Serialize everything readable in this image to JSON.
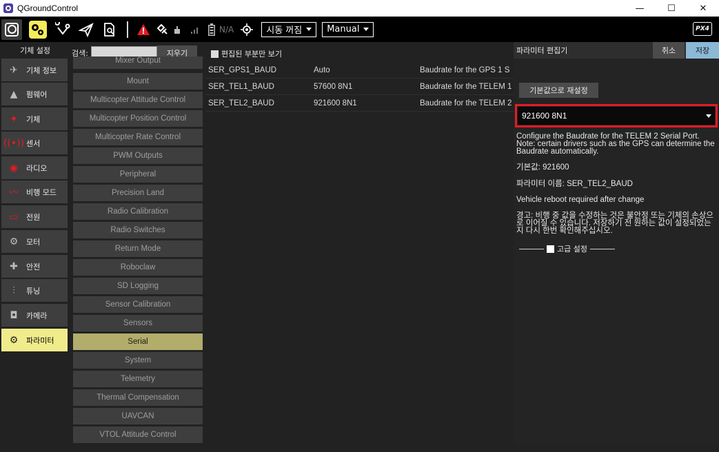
{
  "window": {
    "title": "QGroundControl",
    "controls": {
      "minimize": "—",
      "maximize": "☐",
      "close": "✕"
    }
  },
  "toolbar": {
    "gps_status": "N/A",
    "arm_dropdown": "시동 꺼짐",
    "mode_dropdown": "Manual",
    "logo": "PX4"
  },
  "leftnav": {
    "heading": "기체 설정",
    "items": [
      {
        "label": "기체 정보",
        "icon": "✈"
      },
      {
        "label": "펌웨어",
        "icon": "▲"
      },
      {
        "label": "기체",
        "icon": "✦"
      },
      {
        "label": "센서",
        "icon": "((•))"
      },
      {
        "label": "라디오",
        "icon": "◉"
      },
      {
        "label": "비행 모드",
        "icon": "〰"
      },
      {
        "label": "전원",
        "icon": "▭"
      },
      {
        "label": "모터",
        "icon": "⚙"
      },
      {
        "label": "안전",
        "icon": "✚"
      },
      {
        "label": "튜닝",
        "icon": "⫶"
      },
      {
        "label": "카메라",
        "icon": "◘"
      },
      {
        "label": "파라미터",
        "icon": "⚙"
      }
    ]
  },
  "search": {
    "label": "검색:",
    "value": "",
    "clear_label": "지우기",
    "edited_only_label": "편집된 부분만 보기"
  },
  "groups": [
    "Mixer Output",
    "Mount",
    "Multicopter Attitude Control",
    "Multicopter Position Control",
    "Multicopter Rate Control",
    "PWM Outputs",
    "Peripheral",
    "Precision Land",
    "Radio Calibration",
    "Radio Switches",
    "Return Mode",
    "Roboclaw",
    "SD Logging",
    "Sensor Calibration",
    "Sensors",
    "Serial",
    "System",
    "Telemetry",
    "Thermal Compensation",
    "UAVCAN",
    "VTOL Attitude Control"
  ],
  "selected_group": "Serial",
  "params": [
    {
      "name": "SER_GPS1_BAUD",
      "value": "Auto",
      "desc": "Baudrate for the GPS 1 S"
    },
    {
      "name": "SER_TEL1_BAUD",
      "value": "57600 8N1",
      "desc": "Baudrate for the TELEM 1"
    },
    {
      "name": "SER_TEL2_BAUD",
      "value": "921600 8N1",
      "desc": "Baudrate for the TELEM 2"
    }
  ],
  "editor": {
    "title": "파라미터 편집기",
    "cancel_label": "취소",
    "save_label": "저장",
    "reset_label": "기본값으로 재설정",
    "value": "921600 8N1",
    "description": "Configure the Baudrate for the TELEM 2 Serial Port. Note: certain drivers such as the GPS can determine the Baudrate automatically.",
    "default_value": "기본값: 921600",
    "param_name": "파라미터 이름: SER_TEL2_BAUD",
    "reboot_note": "Vehicle reboot required after change",
    "warning": "경고: 비행 중 값을 수정하는 것은 불안정 또는 기체의 손상으로 이어질 수 있습니다. 저장하기 전 원하는 값이 설정되었는지 다시 한번 확인해주십시오.",
    "advanced_label": "고급 설정"
  },
  "colors": {
    "accent": "#f4ec5a",
    "highlight_border": "#e31b23",
    "save": "#8bb9d6"
  }
}
